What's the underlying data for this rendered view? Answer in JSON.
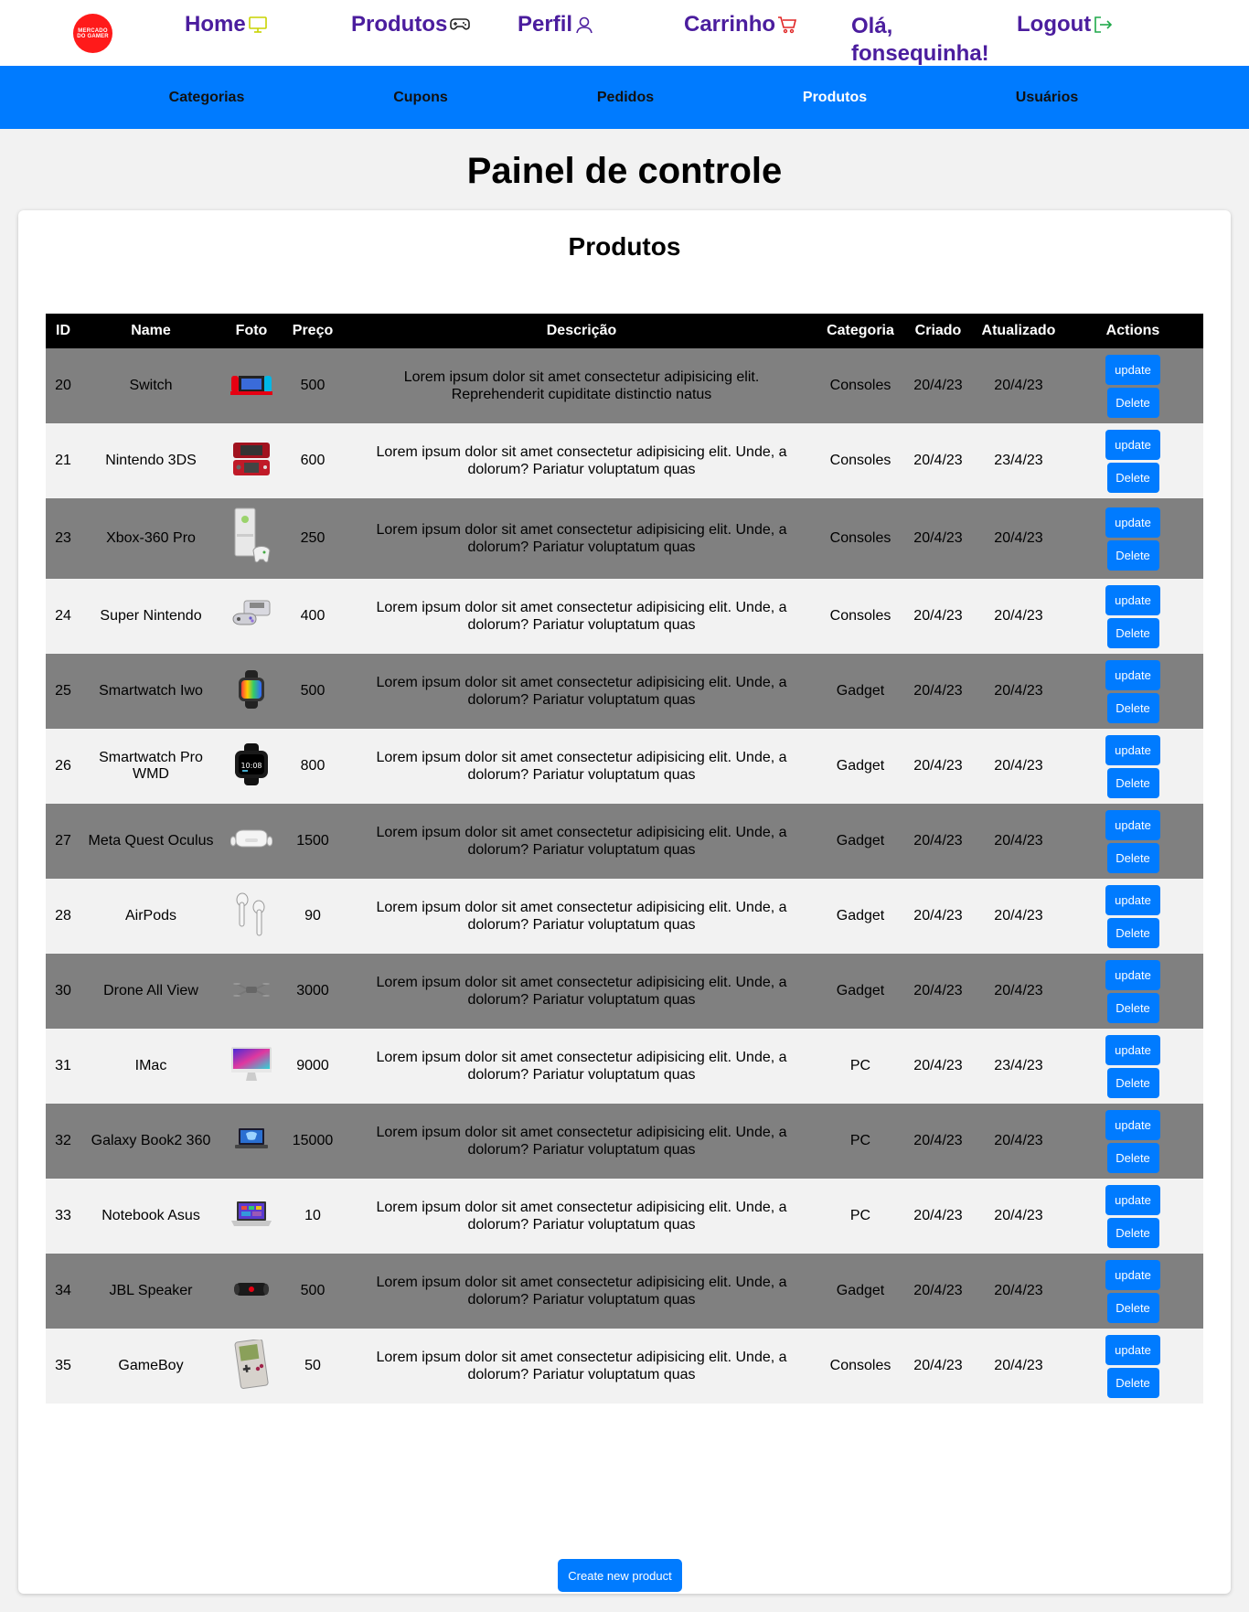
{
  "header": {
    "logo_text": [
      "MERCADO",
      "DO GAMER",
      "ELETRONICOS"
    ],
    "nav": {
      "home": "Home",
      "produtos": "Produtos",
      "perfil": "Perfil",
      "carrinho": "Carrinho",
      "greeting": "Olá, fonsequinha!",
      "logout": "Logout"
    }
  },
  "subnav": {
    "categorias": "Categorias",
    "cupons": "Cupons",
    "pedidos": "Pedidos",
    "produtos": "Produtos",
    "usuarios": "Usuários",
    "active": "produtos"
  },
  "page": {
    "title": "Painel de controle",
    "panel_title": "Produtos",
    "create_button": "Create new product"
  },
  "table": {
    "headers": [
      "ID",
      "Name",
      "Foto",
      "Preço",
      "Descrição",
      "Categoria",
      "Criado",
      "Atualizado",
      "Actions"
    ],
    "update_label": "update",
    "delete_label": "Delete",
    "rows": [
      {
        "id": "20",
        "name": "Switch",
        "foto": "switch",
        "price": "500",
        "desc": "Lorem ipsum dolor sit amet consectetur adipisicing elit. Reprehenderit cupiditate distinctio natus",
        "category": "Consoles",
        "created": "20/4/23",
        "updated": "20/4/23"
      },
      {
        "id": "21",
        "name": "Nintendo 3DS",
        "foto": "3ds",
        "price": "600",
        "desc": "Lorem ipsum dolor sit amet consectetur adipisicing elit. Unde, a dolorum? Pariatur voluptatum quas",
        "category": "Consoles",
        "created": "20/4/23",
        "updated": "23/4/23"
      },
      {
        "id": "23",
        "name": "Xbox-360 Pro",
        "foto": "xbox",
        "price": "250",
        "desc": "Lorem ipsum dolor sit amet consectetur adipisicing elit. Unde, a dolorum? Pariatur voluptatum quas",
        "category": "Consoles",
        "created": "20/4/23",
        "updated": "20/4/23"
      },
      {
        "id": "24",
        "name": "Super Nintendo",
        "foto": "snes",
        "price": "400",
        "desc": "Lorem ipsum dolor sit amet consectetur adipisicing elit. Unde, a dolorum? Pariatur voluptatum quas",
        "category": "Consoles",
        "created": "20/4/23",
        "updated": "20/4/23"
      },
      {
        "id": "25",
        "name": "Smartwatch Iwo",
        "foto": "watch1",
        "price": "500",
        "desc": "Lorem ipsum dolor sit amet consectetur adipisicing elit. Unde, a dolorum? Pariatur voluptatum quas",
        "category": "Gadget",
        "created": "20/4/23",
        "updated": "20/4/23"
      },
      {
        "id": "26",
        "name": "Smartwatch Pro WMD",
        "foto": "watch2",
        "price": "800",
        "desc": "Lorem ipsum dolor sit amet consectetur adipisicing elit. Unde, a dolorum? Pariatur voluptatum quas",
        "category": "Gadget",
        "created": "20/4/23",
        "updated": "20/4/23"
      },
      {
        "id": "27",
        "name": "Meta Quest Oculus",
        "foto": "vr",
        "price": "1500",
        "desc": "Lorem ipsum dolor sit amet consectetur adipisicing elit. Unde, a dolorum? Pariatur voluptatum quas",
        "category": "Gadget",
        "created": "20/4/23",
        "updated": "20/4/23"
      },
      {
        "id": "28",
        "name": "AirPods",
        "foto": "airpods",
        "price": "90",
        "desc": "Lorem ipsum dolor sit amet consectetur adipisicing elit. Unde, a dolorum? Pariatur voluptatum quas",
        "category": "Gadget",
        "created": "20/4/23",
        "updated": "20/4/23"
      },
      {
        "id": "30",
        "name": "Drone All View",
        "foto": "drone",
        "price": "3000",
        "desc": "Lorem ipsum dolor sit amet consectetur adipisicing elit. Unde, a dolorum? Pariatur voluptatum quas",
        "category": "Gadget",
        "created": "20/4/23",
        "updated": "20/4/23"
      },
      {
        "id": "31",
        "name": "IMac",
        "foto": "imac",
        "price": "9000",
        "desc": "Lorem ipsum dolor sit amet consectetur adipisicing elit. Unde, a dolorum? Pariatur voluptatum quas",
        "category": "PC",
        "created": "20/4/23",
        "updated": "23/4/23"
      },
      {
        "id": "32",
        "name": "Galaxy Book2 360",
        "foto": "laptop1",
        "price": "15000",
        "desc": "Lorem ipsum dolor sit amet consectetur adipisicing elit. Unde, a dolorum? Pariatur voluptatum quas",
        "category": "PC",
        "created": "20/4/23",
        "updated": "20/4/23"
      },
      {
        "id": "33",
        "name": "Notebook Asus",
        "foto": "laptop2",
        "price": "10",
        "desc": "Lorem ipsum dolor sit amet consectetur adipisicing elit. Unde, a dolorum? Pariatur voluptatum quas",
        "category": "PC",
        "created": "20/4/23",
        "updated": "20/4/23"
      },
      {
        "id": "34",
        "name": "JBL Speaker",
        "foto": "speaker",
        "price": "500",
        "desc": "Lorem ipsum dolor sit amet consectetur adipisicing elit. Unde, a dolorum? Pariatur voluptatum quas",
        "category": "Gadget",
        "created": "20/4/23",
        "updated": "20/4/23"
      },
      {
        "id": "35",
        "name": "GameBoy",
        "foto": "gameboy",
        "price": "50",
        "desc": "Lorem ipsum dolor sit amet consectetur adipisicing elit. Unde, a dolorum? Pariatur voluptatum quas",
        "category": "Consoles",
        "created": "20/4/23",
        "updated": "20/4/23"
      }
    ]
  },
  "colors": {
    "nav_text": "#4b1d9e",
    "subnav_bg": "#007bff",
    "button": "#007bff",
    "row_dark": "#808080",
    "row_light": "#f2f2f2"
  }
}
